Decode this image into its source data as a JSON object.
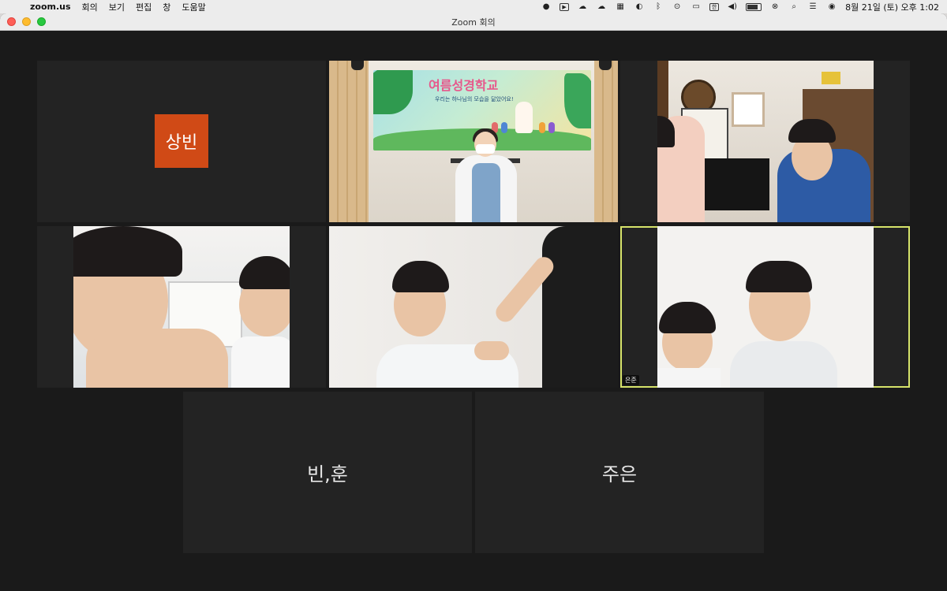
{
  "menubar": {
    "apple_icon": "apple-logo",
    "app_name": "zoom.us",
    "menus": [
      "회의",
      "보기",
      "편집",
      "창",
      "도움말"
    ],
    "clock": "8월 21일 (토) 오후 1:02",
    "status_icons": [
      "zoom-status-icon",
      "video-icon",
      "cloud-icon",
      "cloud-icon",
      "grid-icon",
      "contrast-icon",
      "bluetooth-icon",
      "play-icon",
      "window-icon",
      "keyboard-icon",
      "volume-icon",
      "battery-icon",
      "link-icon",
      "search-icon",
      "control-center-icon",
      "siri-icon"
    ]
  },
  "window": {
    "title": "Zoom 회의",
    "controls": [
      "close",
      "minimize",
      "zoom"
    ]
  },
  "participants": [
    {
      "name": "상빈",
      "video": false
    },
    {
      "name": "",
      "video": true,
      "scene": "teacher-with-banner"
    },
    {
      "name": "",
      "video": true,
      "scene": "two-kids-home"
    },
    {
      "name": "",
      "video": true,
      "scene": "two-kids-closeup"
    },
    {
      "name": "",
      "video": true,
      "scene": "toddler-with-adult"
    },
    {
      "name": "은준",
      "video": true,
      "scene": "two-boys-smiling",
      "active_speaker": true
    },
    {
      "name": "빈,훈",
      "video": false
    },
    {
      "name": "주은",
      "video": false
    }
  ],
  "banner": {
    "title": "여름성경학교",
    "subtitle": "우리는 하나님의 모습을 닮았어요!"
  },
  "colors": {
    "background": "#1a1a1a",
    "tile": "#232323",
    "active_border": "#d6e36a",
    "avatar": "#d04a16"
  }
}
